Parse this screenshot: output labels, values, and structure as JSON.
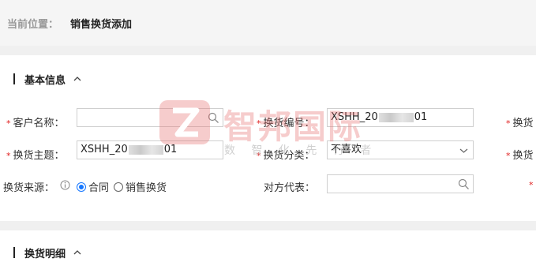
{
  "breadcrumb": {
    "label": "当前位置：",
    "current": "销售换货添加"
  },
  "sections": {
    "basic": "基本信息",
    "detail": "换货明细"
  },
  "form": {
    "customer_name": {
      "label": "客户名称：",
      "value": ""
    },
    "exchange_no": {
      "label": "换货编号：",
      "value_prefix": "XSHH_20",
      "value_suffix": "01"
    },
    "exchange_right1": {
      "label": "换货"
    },
    "exchange_subject": {
      "label": "换货主题：",
      "value_prefix": "XSHH_20",
      "value_suffix": "01"
    },
    "exchange_category": {
      "label": "换货分类：",
      "value": "不喜欢"
    },
    "exchange_right2": {
      "label": "换货"
    },
    "exchange_source": {
      "label": "换货来源：",
      "options": [
        "合同",
        "销售换货"
      ],
      "selected": "合同"
    },
    "counterparty": {
      "label": "对方代表：",
      "value": ""
    }
  },
  "watermark": {
    "brand": "智邦国际",
    "sub": "数 智 化 先 行 者"
  },
  "colors": {
    "required": "#e02020",
    "accent": "#1677ff",
    "watermark": "#e66e6e"
  }
}
